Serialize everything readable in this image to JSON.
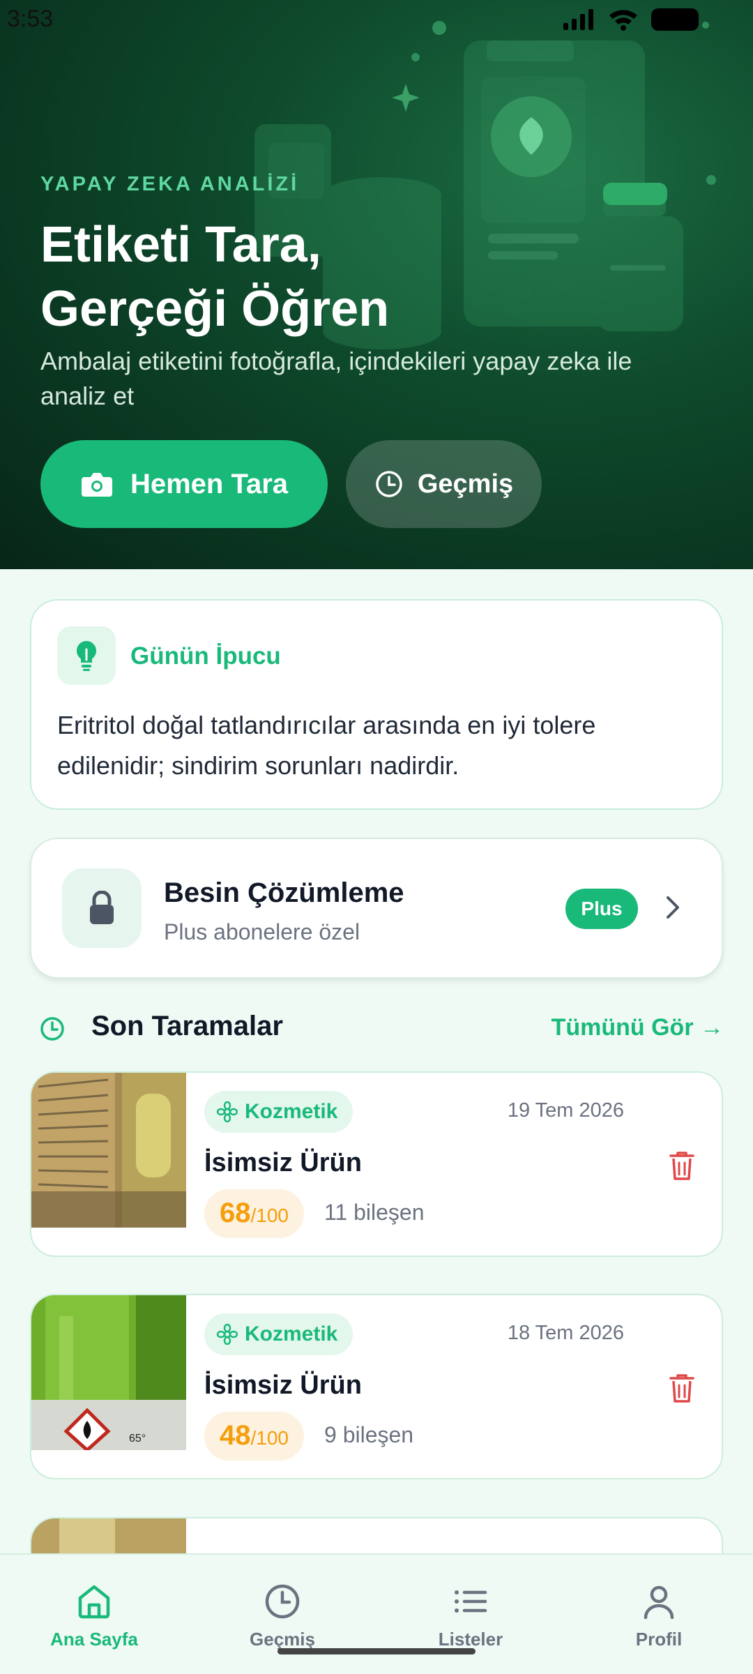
{
  "status_bar": {
    "time": "3:53"
  },
  "hero": {
    "kicker": "YAPAY ZEKA ANALİZİ",
    "title_line1": "Etiketi Tara,",
    "title_line2": "Gerçeği Öğren",
    "subtitle": "Ambalaj etiketini fotoğrafla, içindekileri yapay zeka ile analiz et",
    "primary_button": "Hemen Tara",
    "secondary_button": "Geçmiş"
  },
  "tip": {
    "title": "Günün İpucu",
    "text": "Eritritol doğal tatlandırıcılar arasında en iyi tolere edilenidir; sindirim sorunları nadirdir."
  },
  "premium": {
    "title": "Besin Çözümleme",
    "subtitle": "Plus abonelere özel",
    "badge": "Plus"
  },
  "recent": {
    "title": "Son Taramalar",
    "see_all": "Tümünü Gör →",
    "items": [
      {
        "category": "Kozmetik",
        "date": "19 Tem 2026",
        "name": "İsimsiz Ürün",
        "score": "68",
        "score_max": "/100",
        "ingredients": "11 bileşen"
      },
      {
        "category": "Kozmetik",
        "date": "18 Tem 2026",
        "name": "İsimsiz Ürün",
        "score": "48",
        "score_max": "/100",
        "ingredients": "9 bileşen"
      }
    ]
  },
  "nav": {
    "items": [
      {
        "label": "Ana Sayfa",
        "icon": "home-icon",
        "active": true
      },
      {
        "label": "Geçmiş",
        "icon": "clock-icon",
        "active": false
      },
      {
        "label": "Listeler",
        "icon": "list-icon",
        "active": false
      },
      {
        "label": "Profil",
        "icon": "person-icon",
        "active": false
      }
    ]
  },
  "colors": {
    "accent": "#19b97a",
    "hero_bg": "#0e4a2c",
    "score": "#f59e0b",
    "danger": "#e04848"
  }
}
